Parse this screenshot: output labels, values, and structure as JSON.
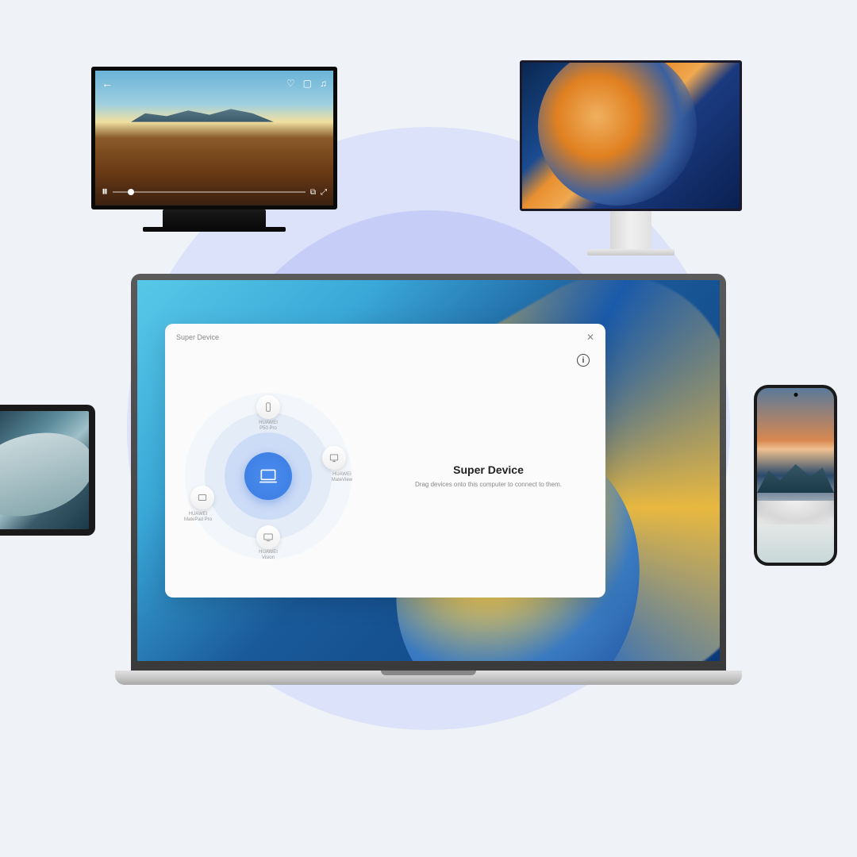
{
  "dialog": {
    "window_title": "Super Device",
    "title": "Super Device",
    "description": "Drag devices onto this computer to connect to them.",
    "devices": {
      "top": "HUAWEI\nP50 Pro",
      "right": "HUAWEI\nMateView",
      "bottom": "HUAWEI\nVision",
      "left": "HUAWEI\nMatePad Pro"
    }
  }
}
